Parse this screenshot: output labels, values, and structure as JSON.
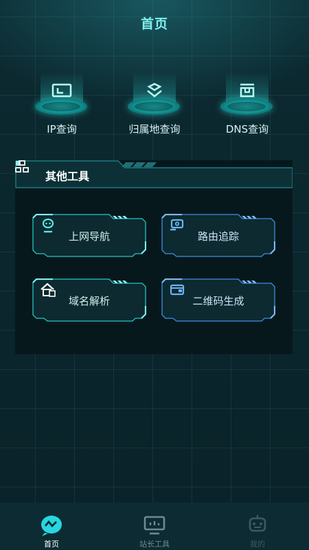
{
  "header": {
    "title": "首页"
  },
  "top_tools": [
    {
      "label": "IP查询",
      "icon": "ip-icon"
    },
    {
      "label": "归属地查询",
      "icon": "location-icon"
    },
    {
      "label": "DNS查询",
      "icon": "dns-icon"
    }
  ],
  "panel": {
    "title": "其他工具",
    "icon": "tools-grid-icon",
    "cards": [
      {
        "label": "上网导航",
        "icon": "robot-icon"
      },
      {
        "label": "路由追踪",
        "icon": "router-icon"
      },
      {
        "label": "域名解析",
        "icon": "house-icon"
      },
      {
        "label": "二维码生成",
        "icon": "wallet-icon"
      }
    ]
  },
  "tabbar": {
    "items": [
      {
        "label": "首页",
        "icon": "home-wave-icon",
        "active": true
      },
      {
        "label": "站长工具",
        "icon": "monitor-icon",
        "active": false
      },
      {
        "label": "我的",
        "icon": "robot-face-icon",
        "active": false
      }
    ]
  },
  "colors": {
    "accent": "#2de0d6",
    "accent_blue": "#3f8fe0",
    "background": "#0a2229"
  }
}
